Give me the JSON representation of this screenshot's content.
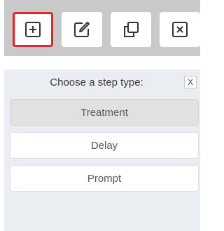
{
  "toolbar": {
    "buttons": [
      {
        "icon": "plus-square-icon",
        "selected": true
      },
      {
        "icon": "edit-icon",
        "selected": false
      },
      {
        "icon": "duplicate-icon",
        "selected": false
      },
      {
        "icon": "close-square-icon",
        "selected": false
      }
    ],
    "selected_border_color": "#e0272d",
    "background_color": "#c9c9c9"
  },
  "dialog": {
    "title": "Choose a step type:",
    "close_label": "X",
    "options": [
      {
        "label": "Treatment",
        "highlighted": true
      },
      {
        "label": "Delay",
        "highlighted": false
      },
      {
        "label": "Prompt",
        "highlighted": false
      }
    ],
    "background_color": "#eaedf2"
  }
}
